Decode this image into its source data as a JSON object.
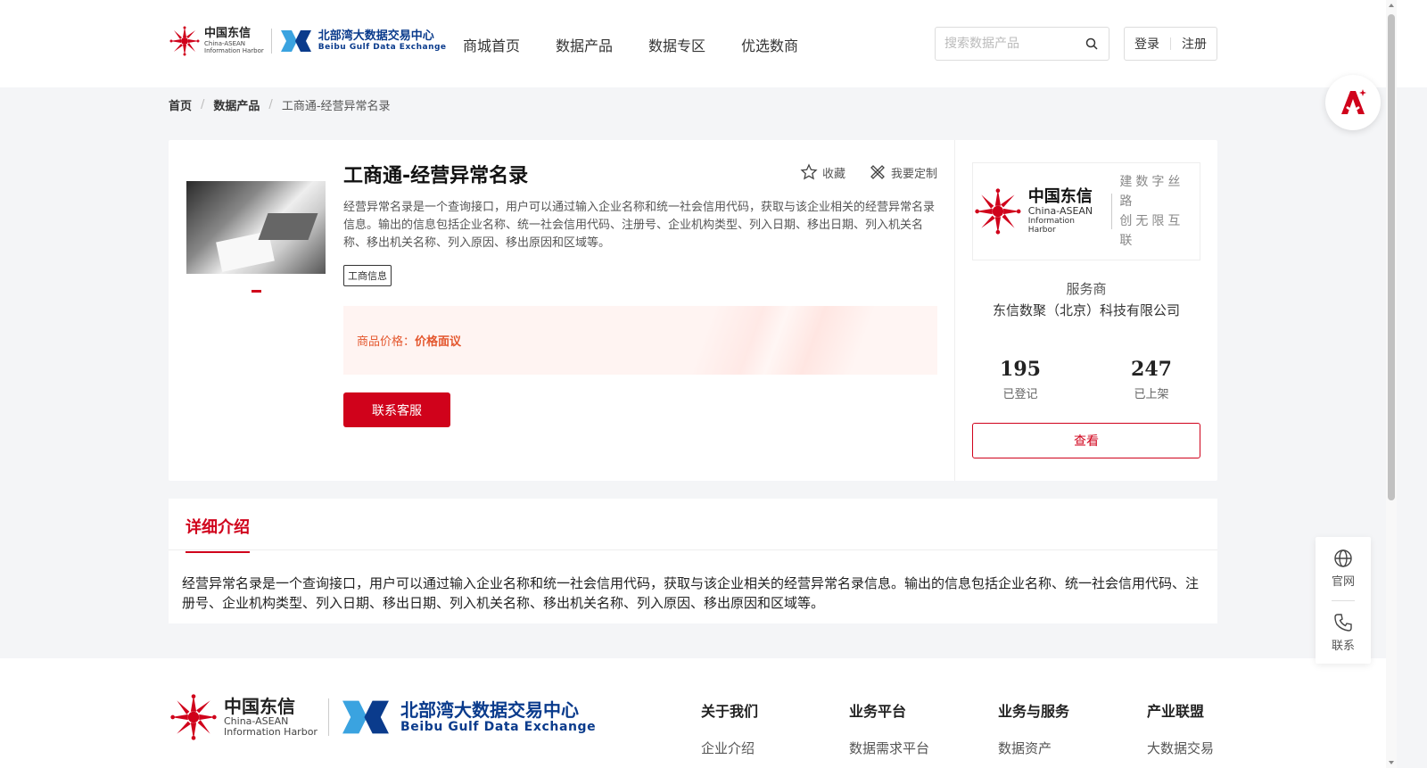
{
  "header": {
    "logo_cn": "中国东信",
    "logo_en_1": "China-ASEAN",
    "logo_en_2": "Information Harbor",
    "logo_bx_cn": "北部湾大数据交易中心",
    "logo_bx_en": "Beibu Gulf Data Exchange",
    "nav": [
      "商城首页",
      "数据产品",
      "数据专区",
      "优选数商"
    ],
    "search_placeholder": "搜索数据产品",
    "login": "登录",
    "register": "注册"
  },
  "breadcrumb": {
    "home": "首页",
    "category": "数据产品",
    "current": "工商通-经营异常名录",
    "separator": "/"
  },
  "product": {
    "title": "工商通-经营异常名录",
    "favorite": "收藏",
    "customize": "我要定制",
    "description": "经营异常名录是一个查询接口，用户可以通过输入企业名称和统一社会信用代码，获取与该企业相关的经营异常名录信息。输出的信息包括企业名称、统一社会信用代码、注册号、企业机构类型、列入日期、移出日期、列入机关名称、移出机关名称、列入原因、移出原因和区域等。",
    "tag": "工商信息",
    "price_label": "商品价格：",
    "price_value": "价格面议",
    "contact_button": "联系客服"
  },
  "vendor": {
    "logo_cn": "中国东信",
    "logo_en_1": "China-ASEAN",
    "logo_en_2": "Information Harbor",
    "slogan_1": "建数字丝路",
    "slogan_2": "创无限互联",
    "label": "服务商",
    "name": "东信数聚（北京）科技有限公司",
    "registered_count": "195",
    "registered_label": "已登记",
    "listed_count": "247",
    "listed_label": "已上架",
    "view_button": "查看"
  },
  "detail": {
    "tab": "详细介绍",
    "text": "经营异常名录是一个查询接口，用户可以通过输入企业名称和统一社会信用代码，获取与该企业相关的经营异常名录信息。输出的信息包括企业名称、统一社会信用代码、注册号、企业机构类型、列入日期、移出日期、列入机关名称、移出机关名称、列入原因、移出原因和区域等。"
  },
  "footer": {
    "columns": [
      {
        "heading": "关于我们",
        "item": "企业介绍"
      },
      {
        "heading": "业务平台",
        "item": "数据需求平台"
      },
      {
        "heading": "业务与服务",
        "item": "数据资产"
      },
      {
        "heading": "产业联盟",
        "item": "大数据交易"
      }
    ]
  },
  "float": {
    "website": "官网",
    "contact": "联系"
  },
  "colors": {
    "accent": "#d0021b",
    "price": "#e4572e",
    "brand_blue": "#0a3b8c"
  }
}
